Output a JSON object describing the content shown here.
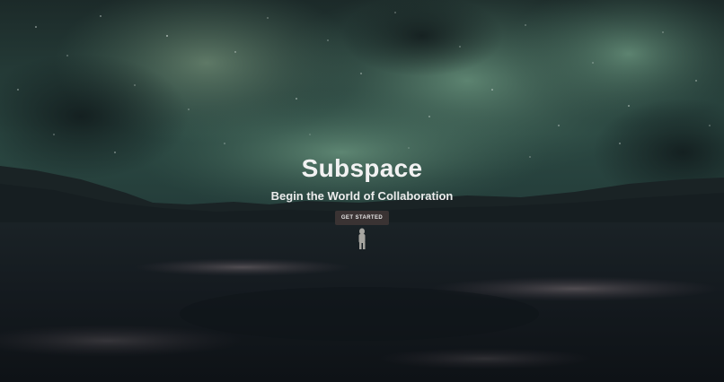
{
  "hero": {
    "title": "Subspace",
    "subtitle": "Begin the World of Collaboration",
    "cta_label": "GET STARTED"
  },
  "colors": {
    "sky_top": "#1b2b2a",
    "nebula_green": "#4e7a66",
    "ground_dark": "#121a1e",
    "button_bg": "#3a3333",
    "text": "#f2f2f2"
  }
}
